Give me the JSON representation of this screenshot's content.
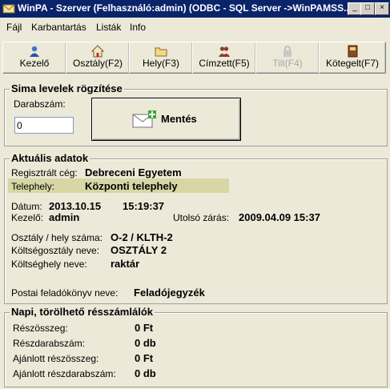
{
  "window": {
    "title": "WinPA - Szerver (Felhasználó:admin) (ODBC - SQL Server ->WinPAMSS...",
    "minimize_label": "_",
    "maximize_label": "□",
    "close_label": "×"
  },
  "menu": {
    "items": [
      "Fájl",
      "Karbantartás",
      "Listák",
      "Info"
    ]
  },
  "toolbar": {
    "buttons": [
      {
        "label": "Kezelő",
        "icon": "user-icon"
      },
      {
        "label": "Osztály(F2)",
        "icon": "house-icon"
      },
      {
        "label": "Hely(F3)",
        "icon": "folder-icon"
      },
      {
        "label": "Címzett(F5)",
        "icon": "people-icon"
      },
      {
        "label": "Tilt(F4)",
        "icon": "lock-icon",
        "disabled": true
      },
      {
        "label": "Kötegelt(F7)",
        "icon": "book-icon"
      }
    ]
  },
  "simple": {
    "title": "Sima levelek rögzítése",
    "count_label": "Darabszám:",
    "count_value": "0",
    "save_label": "Mentés"
  },
  "current": {
    "title": "Aktuális adatok",
    "company_label": "Regisztrált cég:",
    "company_value": "Debreceni Egyetem",
    "site_label": "Telephely:",
    "site_value": "Központi telephely",
    "date_label": "Dátum:",
    "date_value": "2013.10.15",
    "time_value": "15:19:37",
    "operator_label": "Kezelő:",
    "operator_value": "admin",
    "last_close_label": "Utolsó zárás:",
    "last_close_value": "2009.04.09 15:37",
    "dept_place_label": "Osztály / hely száma:",
    "dept_place_value": "O-2 / KLTH-2",
    "cost_dept_label": "Költségosztály neve:",
    "cost_dept_value": "OSZTÁLY 2",
    "cost_place_label": "Költséghely neve:",
    "cost_place_value": "raktár",
    "postbook_label": "Postai feladókönyv neve:",
    "postbook_value": "Feladójegyzék"
  },
  "daily": {
    "title": "Napi, törölhető résszámlálók",
    "rows": [
      {
        "label": "Részösszeg:",
        "value": "0 Ft"
      },
      {
        "label": "Részdarabszám:",
        "value": "0 db"
      },
      {
        "label": "Ajánlott részösszeg:",
        "value": "0 Ft"
      },
      {
        "label": "Ajánlott részdarabszám:",
        "value": "0 db"
      }
    ]
  },
  "colors": {
    "titlebar": "#0a246a",
    "highlight": "#d8d6a4",
    "face": "#ece9d8"
  }
}
